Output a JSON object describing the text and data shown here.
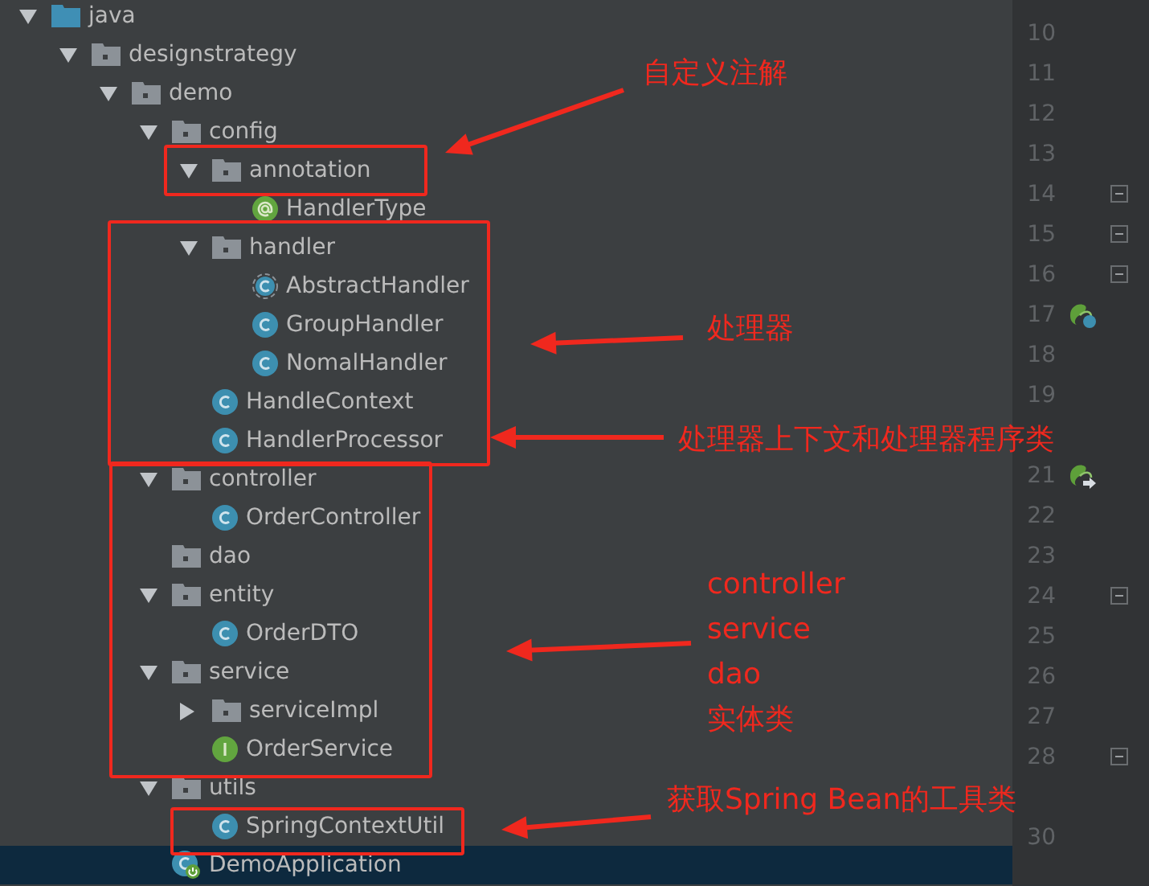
{
  "project_tree": [
    {
      "label": "java",
      "kind": "source-root",
      "expanded": true,
      "selected": false,
      "children": [
        {
          "label": "designstrategy",
          "kind": "package",
          "expanded": true,
          "selected": false,
          "children": [
            {
              "label": "demo",
              "kind": "package",
              "expanded": true,
              "selected": false,
              "children": [
                {
                  "label": "config",
                  "kind": "package",
                  "expanded": true,
                  "selected": false,
                  "children": [
                    {
                      "label": "annotation",
                      "kind": "package",
                      "expanded": true,
                      "selected": false,
                      "children": [
                        {
                          "label": "HandlerType",
                          "kind": "annotation",
                          "selected": false
                        }
                      ]
                    },
                    {
                      "label": "handler",
                      "kind": "package",
                      "expanded": true,
                      "selected": false,
                      "children": [
                        {
                          "label": "AbstractHandler",
                          "kind": "abstract-class",
                          "selected": false
                        },
                        {
                          "label": "GroupHandler",
                          "kind": "class",
                          "selected": false
                        },
                        {
                          "label": "NomalHandler",
                          "kind": "class",
                          "selected": false
                        }
                      ]
                    },
                    {
                      "label": "HandleContext",
                      "kind": "class",
                      "selected": false
                    },
                    {
                      "label": "HandlerProcessor",
                      "kind": "class",
                      "selected": false
                    }
                  ]
                },
                {
                  "label": "controller",
                  "kind": "package",
                  "expanded": true,
                  "selected": false,
                  "children": [
                    {
                      "label": "OrderController",
                      "kind": "class",
                      "selected": false
                    }
                  ]
                },
                {
                  "label": "dao",
                  "kind": "package",
                  "selected": false
                },
                {
                  "label": "entity",
                  "kind": "package",
                  "expanded": true,
                  "selected": false,
                  "children": [
                    {
                      "label": "OrderDTO",
                      "kind": "class",
                      "selected": false
                    }
                  ]
                },
                {
                  "label": "service",
                  "kind": "package",
                  "expanded": true,
                  "selected": false,
                  "children": [
                    {
                      "label": "serviceImpl",
                      "kind": "package",
                      "expanded": false,
                      "selected": false
                    },
                    {
                      "label": "OrderService",
                      "kind": "interface",
                      "selected": false
                    }
                  ]
                },
                {
                  "label": "utils",
                  "kind": "package",
                  "expanded": true,
                  "selected": false,
                  "children": [
                    {
                      "label": "SpringContextUtil",
                      "kind": "class",
                      "selected": false
                    }
                  ]
                },
                {
                  "label": "DemoApplication",
                  "kind": "application",
                  "selected": true
                }
              ]
            }
          ]
        }
      ]
    }
  ],
  "gutter": [
    {
      "line": "10"
    },
    {
      "line": "11"
    },
    {
      "line": "12"
    },
    {
      "line": "13"
    },
    {
      "line": "14",
      "fold": true
    },
    {
      "line": "15",
      "fold": true
    },
    {
      "line": "16",
      "fold": true
    },
    {
      "line": "17",
      "kind": "bean"
    },
    {
      "line": "18"
    },
    {
      "line": "19"
    },
    {
      "kind": "blank"
    },
    {
      "line": "21",
      "kind": "bean-arrow"
    },
    {
      "line": "22"
    },
    {
      "line": "23"
    },
    {
      "line": "24",
      "fold": true
    },
    {
      "line": "25"
    },
    {
      "line": "26"
    },
    {
      "line": "27"
    },
    {
      "line": "28",
      "fold": true
    },
    {
      "kind": "blank"
    },
    {
      "line": "30"
    }
  ],
  "annotations": [
    {
      "lines": [
        "自定义注解"
      ]
    },
    {
      "lines": [
        "处理器"
      ]
    },
    {
      "lines": [
        "处理器上下文和处理器程序类"
      ]
    },
    {
      "lines": [
        "controller",
        "service",
        "dao",
        "实体类"
      ]
    },
    {
      "lines": [
        "获取Spring Bean的工具类"
      ]
    }
  ]
}
